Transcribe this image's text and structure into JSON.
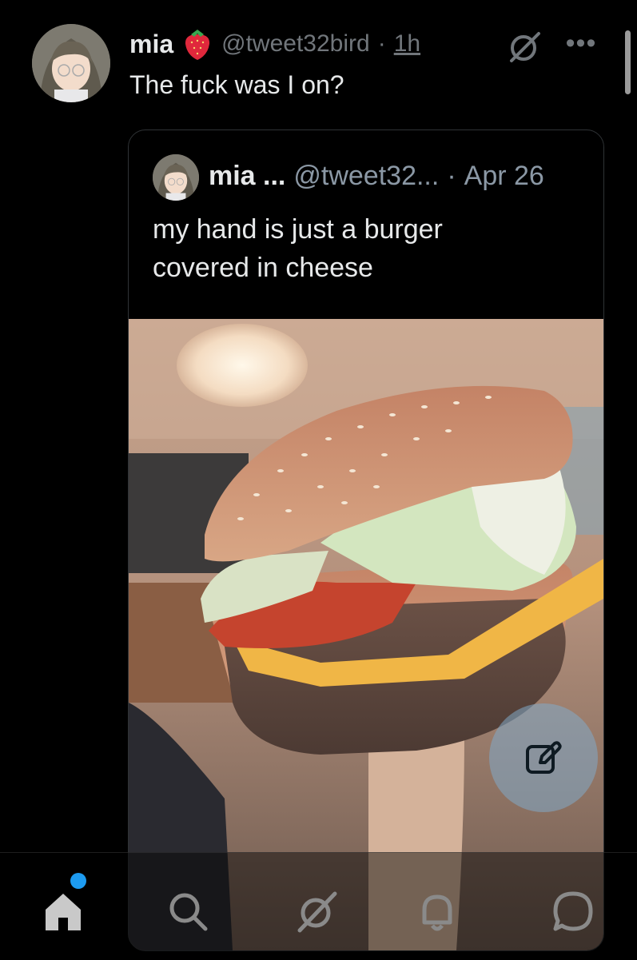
{
  "author": {
    "name": "mia",
    "emoji": "strawberry-icon",
    "handle": "@tweet32bird",
    "separator": "·",
    "time": "1h",
    "text": "The fuck was I on?"
  },
  "quoted": {
    "name": "mia ...",
    "handle": "@tweet32...",
    "separator": "·",
    "date": "Apr 26",
    "text": "my hand is just a burger covered in cheese"
  },
  "nav": {
    "items": [
      "home-icon",
      "search-icon",
      "grok-icon",
      "notifications-icon",
      "messages-icon"
    ],
    "home_has_badge": true
  },
  "colors": {
    "background": "#000000",
    "text": "#e7e9ea",
    "muted": "#71767b",
    "accent": "#1d9bf0"
  }
}
